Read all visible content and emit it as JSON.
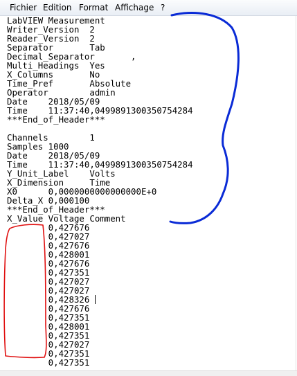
{
  "menu": {
    "items": [
      "Fichier",
      "Edition",
      "Format",
      "Affichage",
      "?"
    ]
  },
  "document": {
    "lines": [
      "LabVIEW Measurement",
      "Writer_Version  2",
      "Reader_Version  2",
      "Separator       Tab",
      "Decimal_Separator       ,",
      "Multi_Headings  Yes",
      "X_Columns       No",
      "Time_Pref       Absolute",
      "Operator        admin",
      "Date    2018/05/09",
      "Time    11:37:40,0499891300350754284",
      "***End_of_Header***",
      "",
      "Channels        1",
      "Samples 1000",
      "Date    2018/05/09",
      "Time    11:37:40,0499891300350754284",
      "Y_Unit_Label    Volts",
      "X_Dimension     Time",
      "X0      0,0000000000000000E+0",
      "Delta_X 0,000100",
      "***End_of_Header***",
      "X_Value Voltage Comment",
      "        0,427676",
      "        0,427027",
      "        0,427676",
      "        0,428001",
      "        0,427676",
      "        0,427351",
      "        0,427027",
      "        0,427027",
      "        0,428326",
      "        0,427676",
      "        0,427351",
      "        0,428001",
      "        0,427351",
      "        0,427027",
      "        0,427351",
      "        0,427351"
    ]
  },
  "annotations": {
    "blue_brace_color": "#0a2bd6",
    "red_box_color": "#e01010"
  }
}
